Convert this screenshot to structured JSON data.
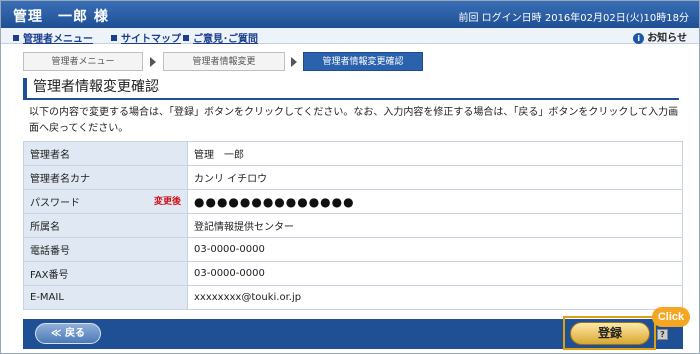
{
  "header": {
    "user_name": "管理　一郎 様",
    "last_login": "前回 ログイン日時 2016年02月02日(火)10時18分"
  },
  "nav": {
    "items": [
      "管理者メニュー",
      "サイトマップ",
      "ご意見･ご質問"
    ],
    "notice_label": "お知らせ"
  },
  "steps": [
    {
      "label": "管理者メニュー"
    },
    {
      "label": "管理者情報変更"
    },
    {
      "label": "管理者情報変更確認"
    }
  ],
  "page": {
    "title": "管理者情報変更確認",
    "description": "以下の内容で変更する場合は、「登録」ボタンをクリックしてください。なお、入力内容を修正する場合は、「戻る」ボタンをクリックして入力画面へ戻ってください。"
  },
  "fields": [
    {
      "label": "管理者名",
      "value": "管理　一郎",
      "changed": ""
    },
    {
      "label": "管理者名カナ",
      "value": "カンリ イチロウ",
      "changed": ""
    },
    {
      "label": "パスワード",
      "value": "●●●●●●●●●●●●●●",
      "changed": "変更後"
    },
    {
      "label": "所属名",
      "value": "登記情報提供センター",
      "changed": ""
    },
    {
      "label": "電話番号",
      "value": "03-0000-0000",
      "changed": ""
    },
    {
      "label": "FAX番号",
      "value": "03-0000-0000",
      "changed": ""
    },
    {
      "label": "E-MAIL",
      "value": "xxxxxxxx@touki.or.jp",
      "changed": ""
    }
  ],
  "footer": {
    "back_label": "≪ 戻る",
    "register_label": "登録",
    "help_label": "?",
    "click_label": "Click"
  },
  "icons": {
    "notice": "info-icon",
    "help": "help-icon"
  },
  "colors": {
    "primary": "#1f4f95",
    "accent_button": "#d9a730",
    "changed_text": "#d0121b"
  }
}
